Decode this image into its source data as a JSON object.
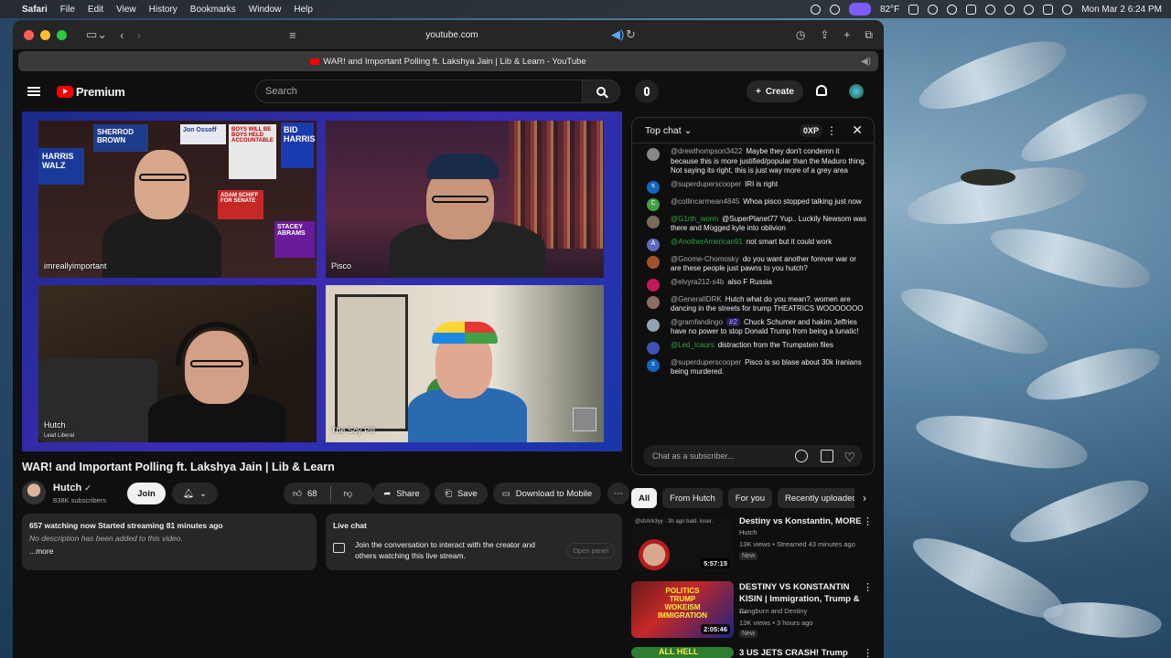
{
  "menubar": {
    "app": "Safari",
    "items": [
      "File",
      "Edit",
      "View",
      "History",
      "Bookmarks",
      "Window",
      "Help"
    ],
    "weather": "82°F",
    "clock": "Mon Mar 2  6:24 PM"
  },
  "browser": {
    "address": "youtube.com",
    "tab_title": "WAR! and Important Polling ft. Lakshya Jain | Lib & Learn - YouTube"
  },
  "youtube": {
    "logo": "Premium",
    "search_placeholder": "Search",
    "create_label": "Create"
  },
  "video": {
    "title": "WAR! and Important Polling ft. Lakshya Jain | Lib & Learn",
    "cams": [
      {
        "name": "imreallyimportant",
        "sub": ""
      },
      {
        "name": "Pisco",
        "sub": ""
      },
      {
        "name": "Hutch",
        "sub": "Lead Liberal"
      },
      {
        "name": "The Soy Pill",
        "sub": ""
      }
    ],
    "poster_texts": [
      "SHERROD BROWN",
      "HARRIS WALZ",
      "Jon Ossoff",
      "BOYS WILL BE BOYS HELD ACCOUNTABLE",
      "BID HARRIS",
      "ADAM SCHIFF FOR SENATE",
      "STACEY ABRAMS"
    ]
  },
  "channel": {
    "name": "Hutch",
    "subscribers": "838K subscribers",
    "join": "Join",
    "likes": "68",
    "share": "Share",
    "save": "Save",
    "download": "Download to Mobile"
  },
  "description": {
    "stats": "657 watching now  Started streaming 81 minutes ago",
    "text": "No description has been added to this video.",
    "more": "...more"
  },
  "livechat_box": {
    "title": "Live chat",
    "text": "Join the conversation to interact with the creator and others watching this live stream.",
    "button": "Open panel"
  },
  "chat": {
    "mode": "Top chat",
    "xp": "0XP",
    "input_placeholder": "Chat as a subscriber...",
    "messages": [
      {
        "author": "@drewthompson3422",
        "text": "Maybe they don't condemn it because this is more justified/popular than the Maduro thing. Not saying its right, this is just way more of a grey area",
        "color": "#888888",
        "initial": "",
        "member": false
      },
      {
        "author": "@superduperscooper",
        "text": "IRI is right",
        "color": "#1565c0",
        "initial": "s",
        "member": false
      },
      {
        "author": "@collincarmean4845",
        "text": "Whoa pisco stopped talking just now",
        "color": "#43a047",
        "initial": "C",
        "member": false
      },
      {
        "author": "@G1rth_worm",
        "text": "@SuperPlanet77 Yup.. Luckily Newsom was there and Mogged kyle into oblivion",
        "color": "#7b6a55",
        "initial": "",
        "member": true
      },
      {
        "author": "@AnotherAmerican91",
        "text": "not smart but it could work",
        "color": "#5c6bc0",
        "initial": "A",
        "member": true
      },
      {
        "author": "@Gnome-Chomosky",
        "text": "do you want another forever war or are these people just pawns to you hutch?",
        "color": "#a0522d",
        "initial": "",
        "member": false
      },
      {
        "author": "@elvyra212-s4b",
        "text": "also F Russia",
        "color": "#c2185b",
        "initial": "",
        "member": false
      },
      {
        "author": "@GeneralIDRK",
        "text": "Hutch what do you mean?. women are dancing in the streets for trump THEATRICS WOOOOOOO",
        "color": "#8d6e63",
        "initial": "",
        "member": false
      },
      {
        "author": "@gramfandingo",
        "text": "Chuck Schumer and hakim Jeffries have no power to stop Donald Trump from being a lunatic!",
        "color": "#90a4ae",
        "initial": "",
        "member": false,
        "badge": "#2"
      },
      {
        "author": "@Led_Icaurs",
        "text": "distraction from the Trumpstein files",
        "color": "#3f51b5",
        "initial": "",
        "member": true
      },
      {
        "author": "@superduperscooper",
        "text": "Pisco is so blase about 30k Iranians being murdered.",
        "color": "#1565c0",
        "initial": "s",
        "member": false
      }
    ]
  },
  "chips": [
    "All",
    "From Hutch",
    "For you",
    "Recently uploaded"
  ],
  "related": [
    {
      "title": "Destiny vs Konstantin, MORE",
      "channel": "Hutch",
      "meta": "13K views • Streamed 43 minutes ago",
      "badge": "New",
      "duration": "5:57:15",
      "thumb_note": "@shArk3yy · 3h ago  bald. loser."
    },
    {
      "title": "DESTINY VS KONSTANTIN KISIN | Immigration, Trump & ...",
      "channel": "Pangburn and Destiny",
      "meta": "13K views • 3 hours ago",
      "badge": "New",
      "duration": "2:05:46",
      "thumb_note": "POLITICS  TRUMP WOKEISM IMMIGRATION"
    },
    {
      "title": "3 US JETS CRASH! Trump",
      "channel": "",
      "meta": "",
      "badge": "",
      "duration": "",
      "thumb_note": "ALL HELL"
    }
  ]
}
